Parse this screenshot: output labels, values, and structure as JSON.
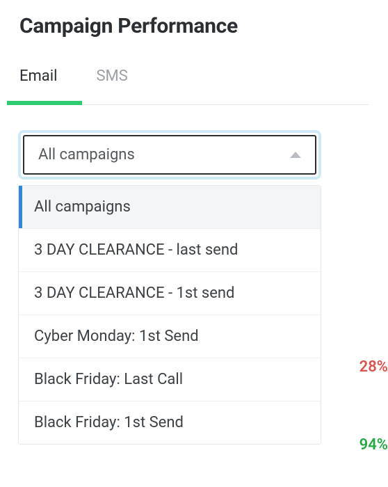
{
  "header": {
    "title": "Campaign Performance"
  },
  "tabs": {
    "items": [
      {
        "label": "Email",
        "active": true
      },
      {
        "label": "SMS",
        "active": false
      }
    ]
  },
  "campaignSelect": {
    "selected": "All campaigns",
    "options": [
      "All campaigns",
      "3 DAY CLEARANCE - last send",
      "3 DAY CLEARANCE - 1st send",
      "Cyber Monday: 1st Send",
      "Black Friday: Last Call",
      "Black Friday: 1st Send"
    ]
  },
  "backgroundMetrics": {
    "metric1": {
      "value": "28%",
      "color": "#d9534f"
    },
    "metric2": {
      "value": "94%",
      "color": "#28a745"
    }
  }
}
